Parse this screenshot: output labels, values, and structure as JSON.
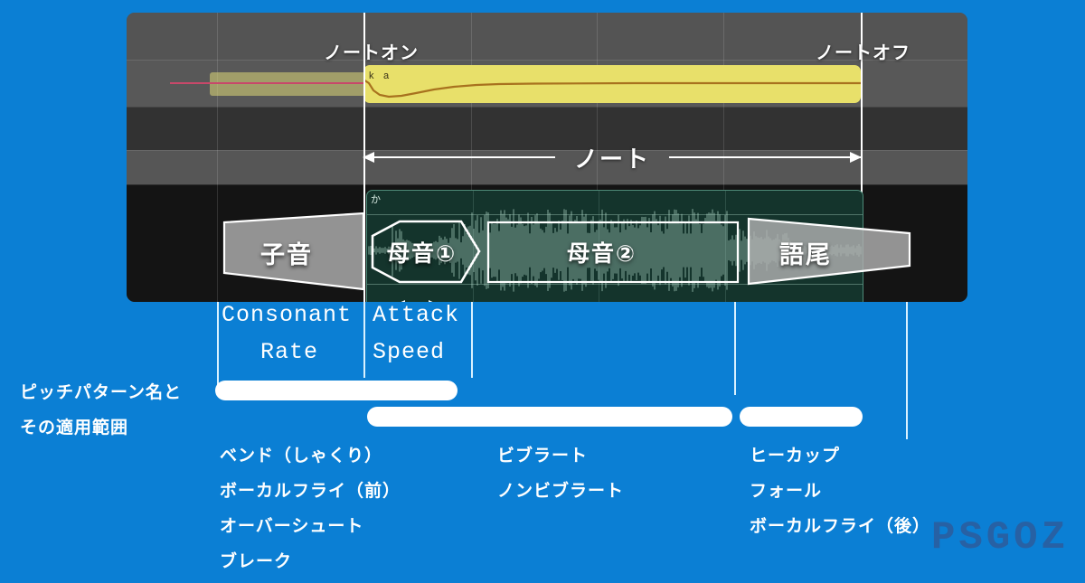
{
  "editor": {
    "note_on_label": "ノートオン",
    "note_off_label": "ノートオフ",
    "note_span_label": "ノート",
    "phoneme_k": "k",
    "phoneme_a": "a",
    "lyric_kana": "か",
    "note_color": "#e8e06a",
    "pitch_curve_color": "#a8721e",
    "ghost_pitch_color": "#c8486a",
    "wave_region_color": "#14342c",
    "panel_background": "#4e4e4e"
  },
  "segments": [
    {
      "id": "consonant",
      "label": "子音",
      "shape": "trapezoid-right"
    },
    {
      "id": "vowel1",
      "label": "母音①",
      "shape": "hexagon"
    },
    {
      "id": "vowel2",
      "label": "母音②",
      "shape": "rectangle"
    },
    {
      "id": "ending",
      "label": "語尾",
      "shape": "trapezoid-left"
    }
  ],
  "parameters": [
    {
      "id": "consonant-rate",
      "line1": "Consonant",
      "line2": "Rate"
    },
    {
      "id": "attack-speed",
      "line1": "Attack",
      "line2": "Speed"
    }
  ],
  "side_label": {
    "line1": "ピッチパターン名と",
    "line2": "その適用範囲"
  },
  "pattern_groups": [
    {
      "id": "attack-patterns",
      "items": [
        "ベンド（しゃくり）",
        "ボーカルフライ（前）",
        "オーバーシュート",
        "ブレーク"
      ]
    },
    {
      "id": "sustain-patterns",
      "items": [
        "ビブラート",
        "ノンビブラート"
      ]
    },
    {
      "id": "release-patterns",
      "items": [
        "ヒーカップ",
        "フォール",
        "ボーカルフライ（後）"
      ]
    }
  ],
  "watermark": "PSGOZ",
  "theme": {
    "background": "#0b7fd4",
    "pill_color": "#ffffff",
    "guide_color": "#d9f1ff",
    "watermark_color": "#2a5fa0"
  }
}
